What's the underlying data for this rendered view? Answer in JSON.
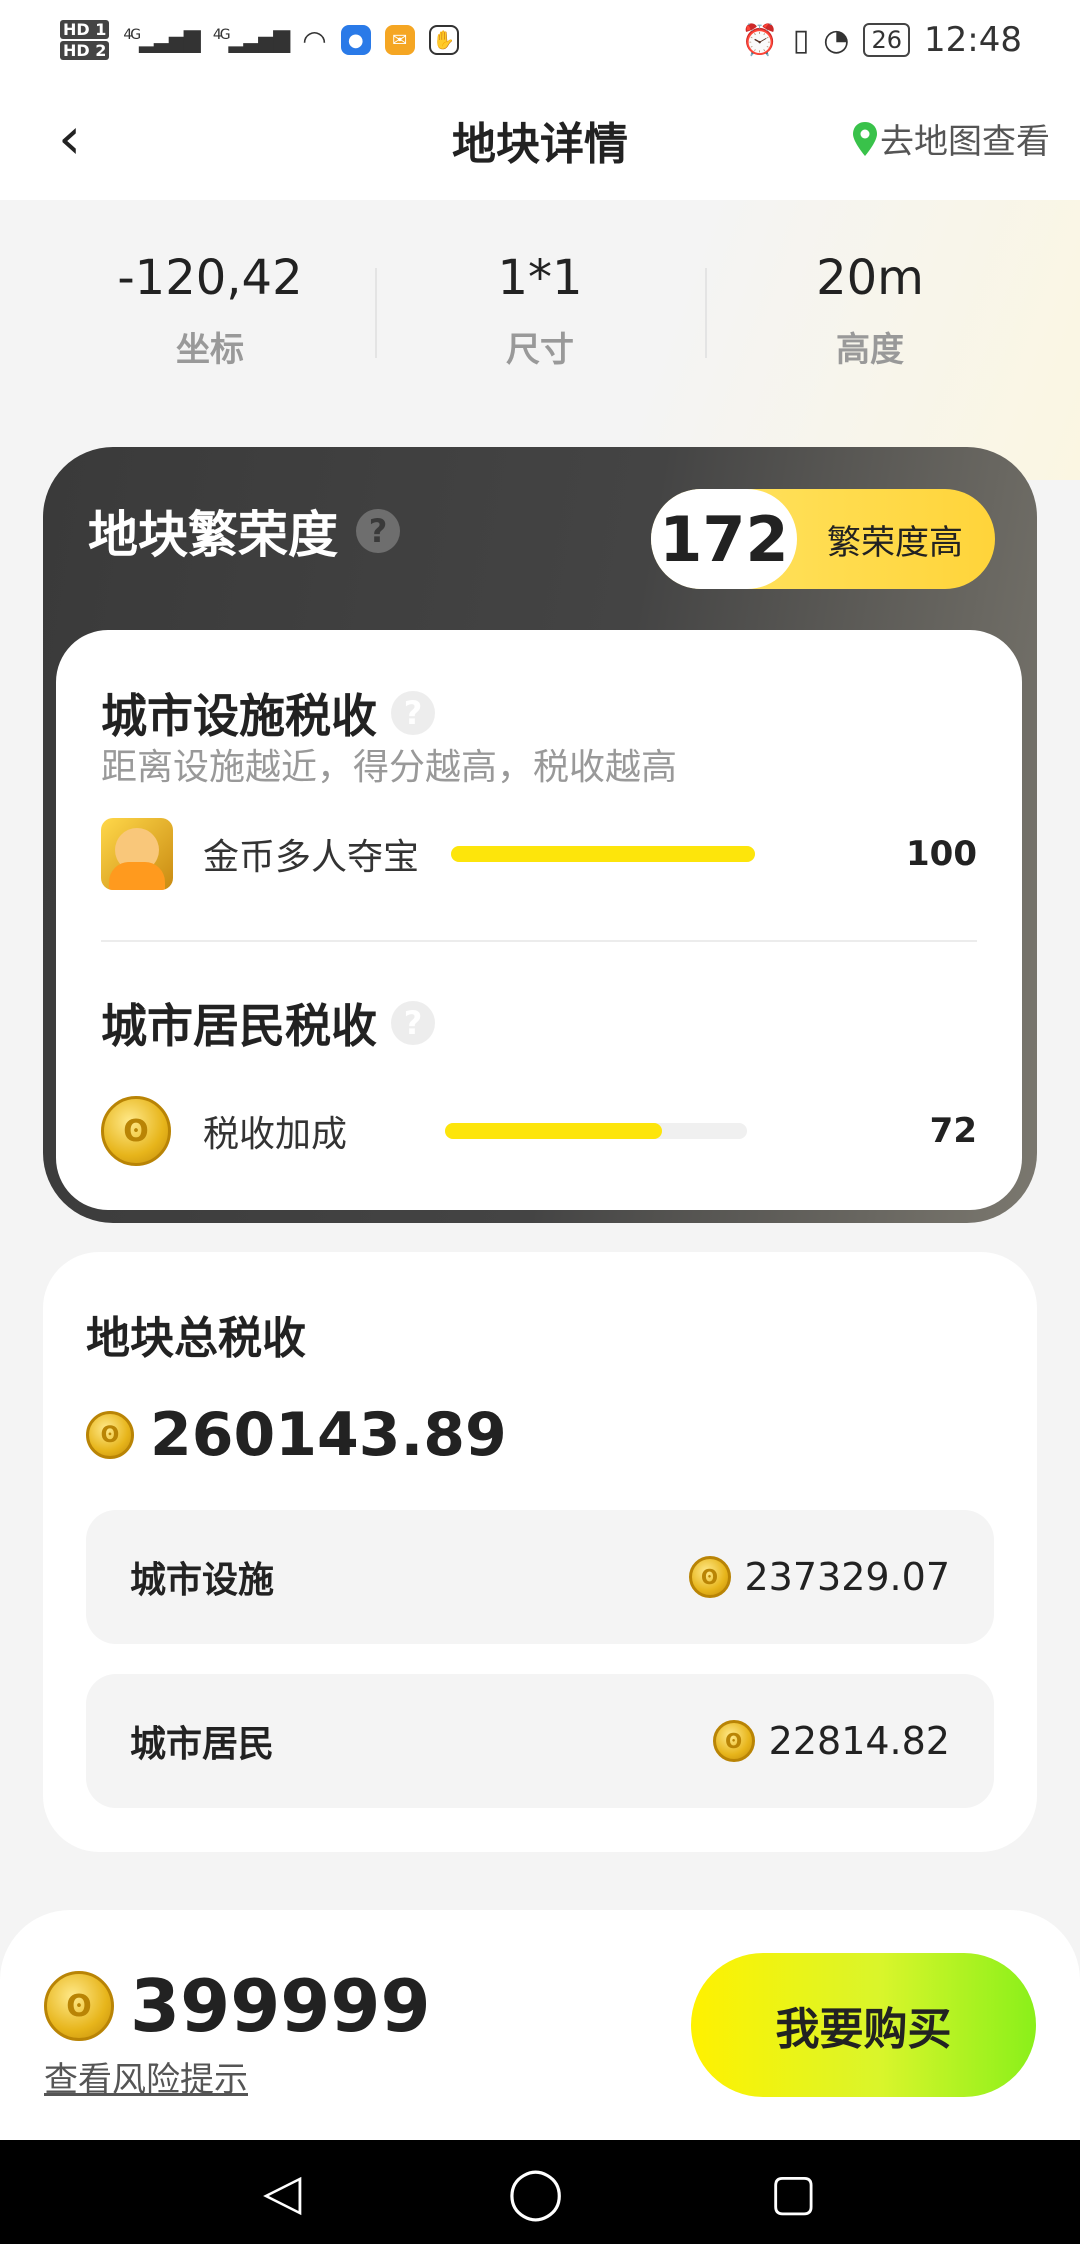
{
  "status_bar": {
    "sim1": "HD 1",
    "sim2": "HD 2",
    "net1": "4G",
    "net2": "4G",
    "battery": "26",
    "time": "12:48"
  },
  "nav": {
    "title": "地块详情",
    "map_link": "去地图查看"
  },
  "stats": [
    {
      "value": "-120,42",
      "label": "坐标"
    },
    {
      "value": "1*1",
      "label": "尺寸"
    },
    {
      "value": "20m",
      "label": "高度"
    }
  ],
  "prosperity": {
    "title": "地块繁荣度",
    "score": "172",
    "level": "繁荣度高",
    "facility_tax": {
      "title": "城市设施税收",
      "subtitle": "距离设施越近，得分越高，税收越高",
      "item_label": "金币多人夺宝",
      "item_value": "100",
      "progress": 1.0
    },
    "resident_tax": {
      "title": "城市居民税收",
      "item_label": "税收加成",
      "item_value": "72",
      "progress": 0.72
    }
  },
  "total_tax": {
    "title": "地块总税收",
    "amount": "260143.89",
    "rows": [
      {
        "label": "城市设施",
        "value": "237329.07"
      },
      {
        "label": "城市居民",
        "value": "22814.82"
      }
    ]
  },
  "purchase": {
    "price": "399999",
    "risk_link": "查看风险提示",
    "buy_label": "我要购买"
  },
  "colors": {
    "accent_yellow": "#fde50b",
    "buy_gradient_end": "#8af01a",
    "dark_card": "#3a3a3a"
  }
}
